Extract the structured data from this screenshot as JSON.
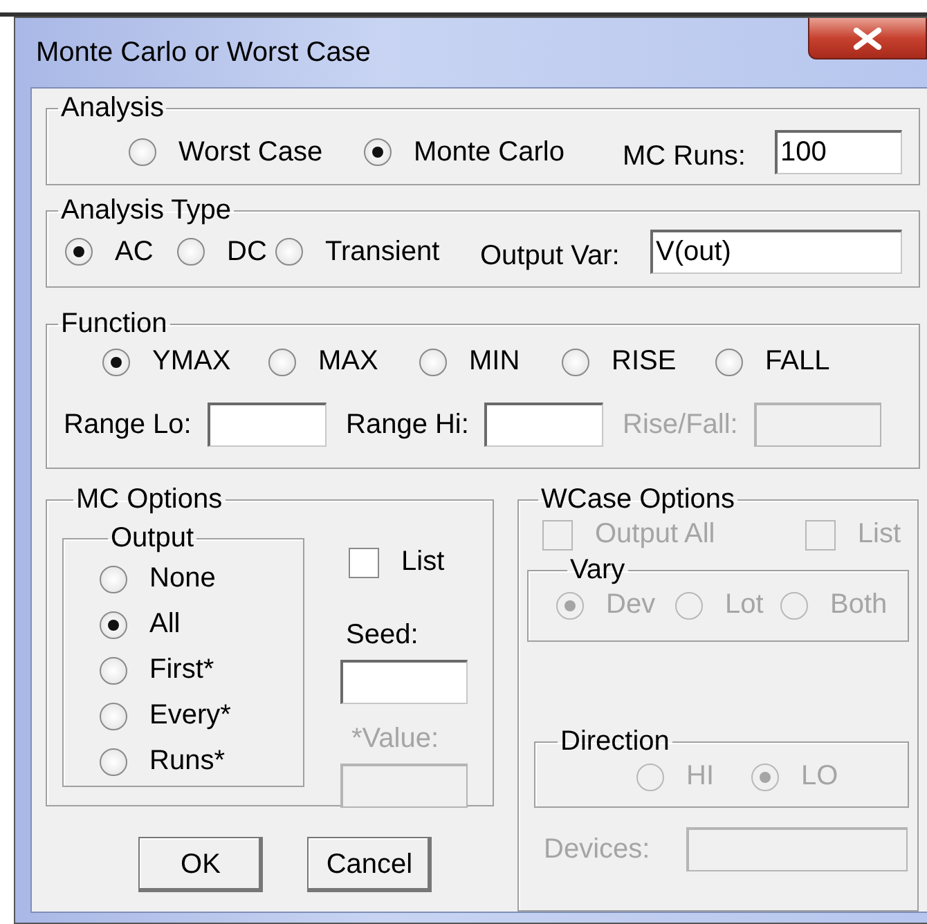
{
  "window": {
    "title": "Monte Carlo or Worst Case"
  },
  "analysis": {
    "label": "Analysis",
    "options": [
      {
        "label": "Worst Case",
        "selected": false
      },
      {
        "label": "Monte Carlo",
        "selected": true
      }
    ],
    "mc_runs": {
      "label": "MC Runs:",
      "value": "100"
    }
  },
  "analysis_type": {
    "label": "Analysis Type",
    "options": [
      {
        "label": "AC",
        "selected": true
      },
      {
        "label": "DC",
        "selected": false
      },
      {
        "label": "Transient",
        "selected": false
      }
    ],
    "output_var": {
      "label": "Output Var:",
      "value": "V(out)"
    }
  },
  "function": {
    "label": "Function",
    "options": [
      {
        "label": "YMAX",
        "selected": true
      },
      {
        "label": "MAX",
        "selected": false
      },
      {
        "label": "MIN",
        "selected": false
      },
      {
        "label": "RISE",
        "selected": false
      },
      {
        "label": "FALL",
        "selected": false
      }
    ],
    "fields": [
      {
        "label": "Range Lo:",
        "disabled": false
      },
      {
        "label": "Range Hi:",
        "disabled": false
      },
      {
        "label": "Rise/Fall:",
        "disabled": true
      }
    ]
  },
  "mc_options": {
    "label": "MC Options",
    "output": {
      "label": "Output",
      "options": [
        {
          "label": "None",
          "selected": false
        },
        {
          "label": "All",
          "selected": true
        },
        {
          "label": "First*",
          "selected": false
        },
        {
          "label": "Every*",
          "selected": false
        },
        {
          "label": "Runs*",
          "selected": false
        }
      ]
    },
    "list": {
      "label": "List",
      "checked": false
    },
    "seed": {
      "label": "Seed:",
      "disabled": false
    },
    "value": {
      "label": "*Value:",
      "disabled": true
    }
  },
  "wcase_options": {
    "label": "WCase Options",
    "disabled": true,
    "output_all": {
      "label": "Output All",
      "checked": false
    },
    "list": {
      "label": "List",
      "checked": false
    },
    "vary": {
      "label": "Vary",
      "options": [
        {
          "label": "Dev",
          "selected": true
        },
        {
          "label": "Lot",
          "selected": false
        },
        {
          "label": "Both",
          "selected": false
        }
      ]
    },
    "direction": {
      "label": "Direction",
      "options": [
        {
          "label": "HI",
          "selected": false
        },
        {
          "label": "LO",
          "selected": true
        }
      ]
    },
    "devices": {
      "label": "Devices:"
    }
  },
  "buttons": [
    {
      "label": "OK"
    },
    {
      "label": "Cancel"
    }
  ]
}
